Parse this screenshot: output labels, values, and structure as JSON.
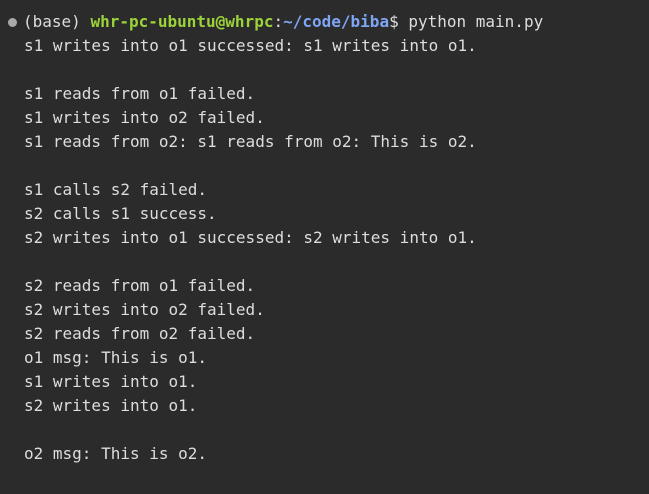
{
  "terminal": {
    "prompt": {
      "env": "(base) ",
      "user_host": "whr-pc-ubuntu@whrpc",
      "separator": ":",
      "cwd": "~/code/biba",
      "symbol": "$ ",
      "command": "python main.py"
    },
    "output": [
      "s1 writes into o1 successed: s1 writes into o1.",
      "",
      "s1 reads from o1 failed.",
      "s1 writes into o2 failed.",
      "s1 reads from o2: s1 reads from o2: This is o2.",
      "",
      "s1 calls s2 failed.",
      "s2 calls s1 success.",
      "s2 writes into o1 successed: s2 writes into o1.",
      "",
      "s2 reads from o1 failed.",
      "s2 writes into o2 failed.",
      "s2 reads from o2 failed.",
      "o1 msg: This is o1.",
      "s1 writes into o1.",
      "s2 writes into o1.",
      "",
      "o2 msg: This is o2."
    ]
  }
}
